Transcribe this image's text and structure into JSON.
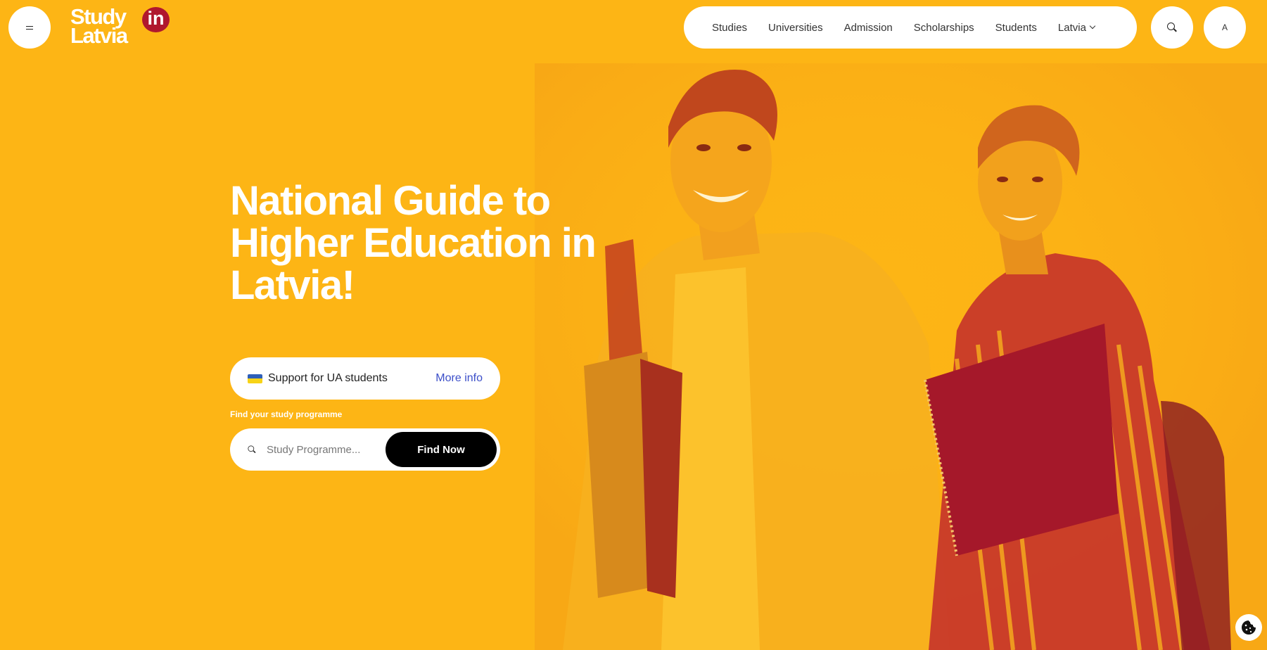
{
  "header": {
    "logo_line1": "Study",
    "logo_line2": "Latvia",
    "logo_badge": "in",
    "nav_items": [
      "Studies",
      "Universities",
      "Admission",
      "Scholarships",
      "Students"
    ],
    "language_label": "Latvia",
    "accessibility_label": "A"
  },
  "hero": {
    "headline": "National Guide to Higher Education in Latvia!",
    "ua_support": {
      "label": "Support for UA students",
      "link": "More info"
    },
    "find_label": "Find your study programme",
    "search": {
      "placeholder": "Study Programme...",
      "button": "Find Now"
    }
  },
  "colors": {
    "background": "#fdb515",
    "brand_red": "#b0172e",
    "link_blue": "#3c4fc9"
  },
  "icons": [
    "hamburger-menu-icon",
    "search-icon",
    "chevron-down-icon",
    "ua-flag-icon",
    "cookie-icon"
  ]
}
